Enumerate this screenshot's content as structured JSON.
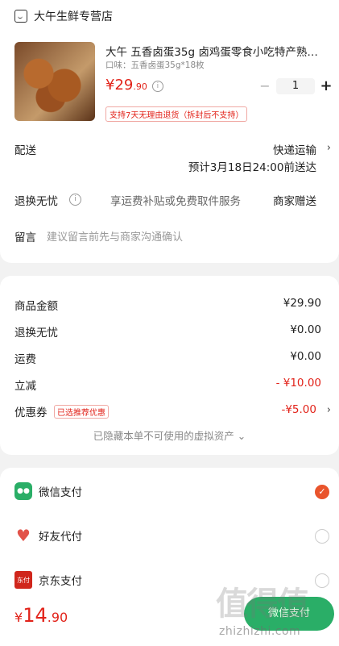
{
  "store": {
    "name": "大午生鲜专营店",
    "icon": "store-icon"
  },
  "product": {
    "title": "大午 五香卤蛋35g 卤鸡蛋零食小吃特产熟…",
    "spec": "口味：五香卤蛋35g*18枚",
    "price_symbol": "¥",
    "price_int": "29",
    "price_dec": ".90",
    "quantity": "1",
    "return_policy": "支持7天无理由退货（拆封后不支持）"
  },
  "delivery": {
    "label": "配送",
    "method": "快递运输",
    "eta": "预计3月18日24:00前送达"
  },
  "return_worry": {
    "label": "退换无忧",
    "desc": "享运费补贴或免费取件服务",
    "value": "商家赠送"
  },
  "message": {
    "label": "留言",
    "placeholder": "建议留言前先与商家沟通确认"
  },
  "summary": {
    "rows": [
      {
        "label": "商品金额",
        "value": "¥29.90"
      },
      {
        "label": "退换无忧",
        "value": "¥0.00"
      },
      {
        "label": "运费",
        "value": "¥0.00"
      },
      {
        "label": "立减",
        "value": "- ¥10.00"
      },
      {
        "label": "优惠券",
        "value": "-¥5.00"
      }
    ],
    "coupon_tag": "已选推荐优惠",
    "hidden_assets": "已隐藏本单不可使用的虚拟资产 ⌄"
  },
  "payment": {
    "options": [
      {
        "label": "微信支付",
        "selected": true
      },
      {
        "label": "好友代付",
        "selected": false
      },
      {
        "label": "京东支付",
        "selected": false
      }
    ],
    "jd_icon_text": "东付"
  },
  "bottom": {
    "total_symbol": "¥",
    "total_int": "14",
    "total_dec": ".90",
    "pay_button": "微信支付"
  },
  "watermark": {
    "logo": "值得值",
    "url": "zhizhizhi.com"
  },
  "colors": {
    "accent_red": "#e2231a",
    "wechat_green": "#2aae67",
    "radio_orange": "#e9542c"
  }
}
